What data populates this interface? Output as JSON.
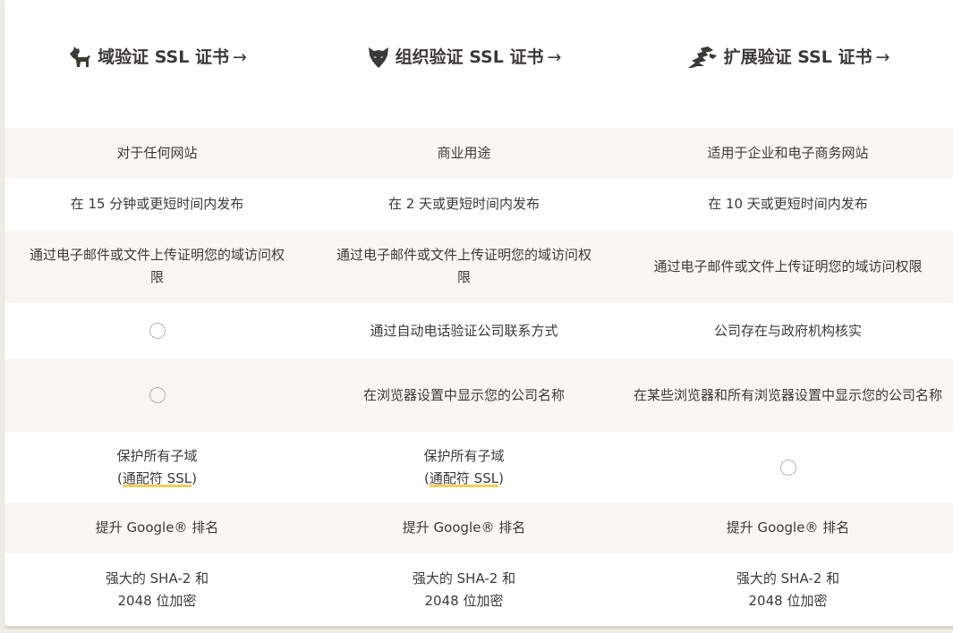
{
  "columns": [
    {
      "title": "域验证 SSL 证书",
      "arrow": "→",
      "icon": "dog-icon"
    },
    {
      "title": "组织验证 SSL 证书",
      "arrow": "→",
      "icon": "wolf-icon"
    },
    {
      "title": "扩展验证 SSL 证书",
      "arrow": "→",
      "icon": "dragon-icon"
    }
  ],
  "rows": {
    "use_case": [
      "对于任何网站",
      "商业用途",
      "适用于企业和电子商务网站"
    ],
    "issuance": [
      "在 15 分钟或更短时间内发布",
      "在 2 天或更短时间内发布",
      "在 10 天或更短时间内发布"
    ],
    "domain_proof": [
      "通过电子邮件或文件上传证明您的域访问权限",
      "通过电子邮件或文件上传证明您的域访问权限",
      "通过电子邮件或文件上传证明您的域访问权限"
    ],
    "company_verify": [
      "",
      "通过自动电话验证公司联系方式",
      "公司存在与政府机构核实"
    ],
    "browser_display": [
      "",
      "在浏览器设置中显示您的公司名称",
      "在某些浏览器和所有浏览器设置中显示您的公司名称"
    ],
    "subdomains": {
      "line1": "保护所有子域",
      "paren_open": "(",
      "link": "通配符 SSL",
      "paren_close": ")"
    },
    "google": [
      "提升 Google® 排名",
      "提升 Google® 排名",
      "提升 Google® 排名"
    ],
    "encryption": {
      "line1": "强大的 SHA-2 和",
      "line2": "2048 位加密"
    }
  },
  "colors": {
    "accent": "#f2cf5b",
    "text": "#3c3a35",
    "shade": "#f8f7f2"
  }
}
